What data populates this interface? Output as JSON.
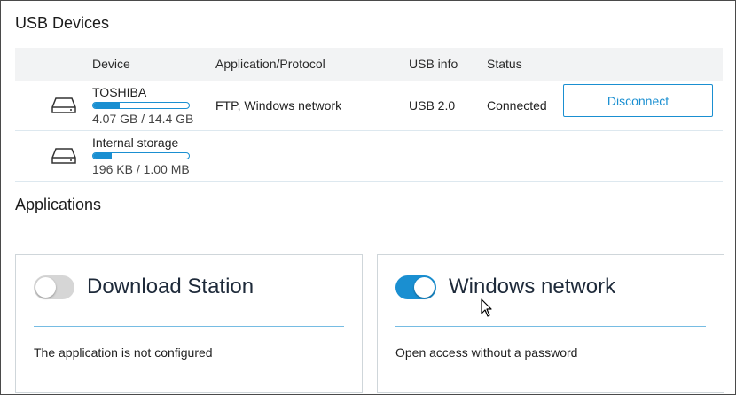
{
  "usb": {
    "title": "USB Devices",
    "columns": {
      "device": "Device",
      "app_protocol": "Application/Protocol",
      "usb_info": "USB info",
      "status": "Status"
    },
    "devices": [
      {
        "icon": "drive-icon",
        "name": "TOSHIBA",
        "usage_fraction": 0.28,
        "size": "4.07 GB / 14.4 GB",
        "protocols": "FTP, Windows network",
        "usb_info": "USB 2.0",
        "status": "Connected",
        "action_label": "Disconnect"
      },
      {
        "icon": "drive-icon",
        "name": "Internal storage",
        "usage_fraction": 0.19,
        "size": "196 KB / 1.00 MB"
      }
    ]
  },
  "applications": {
    "title": "Applications",
    "cards": [
      {
        "name": "Download Station",
        "enabled": false,
        "description": "The application is not configured"
      },
      {
        "name": "Windows network",
        "enabled": true,
        "description": "Open access without a password"
      }
    ]
  },
  "colors": {
    "accent": "#1a8fd1",
    "header_bg": "#f2f3f4",
    "toggle_off": "#d6d6d6"
  }
}
